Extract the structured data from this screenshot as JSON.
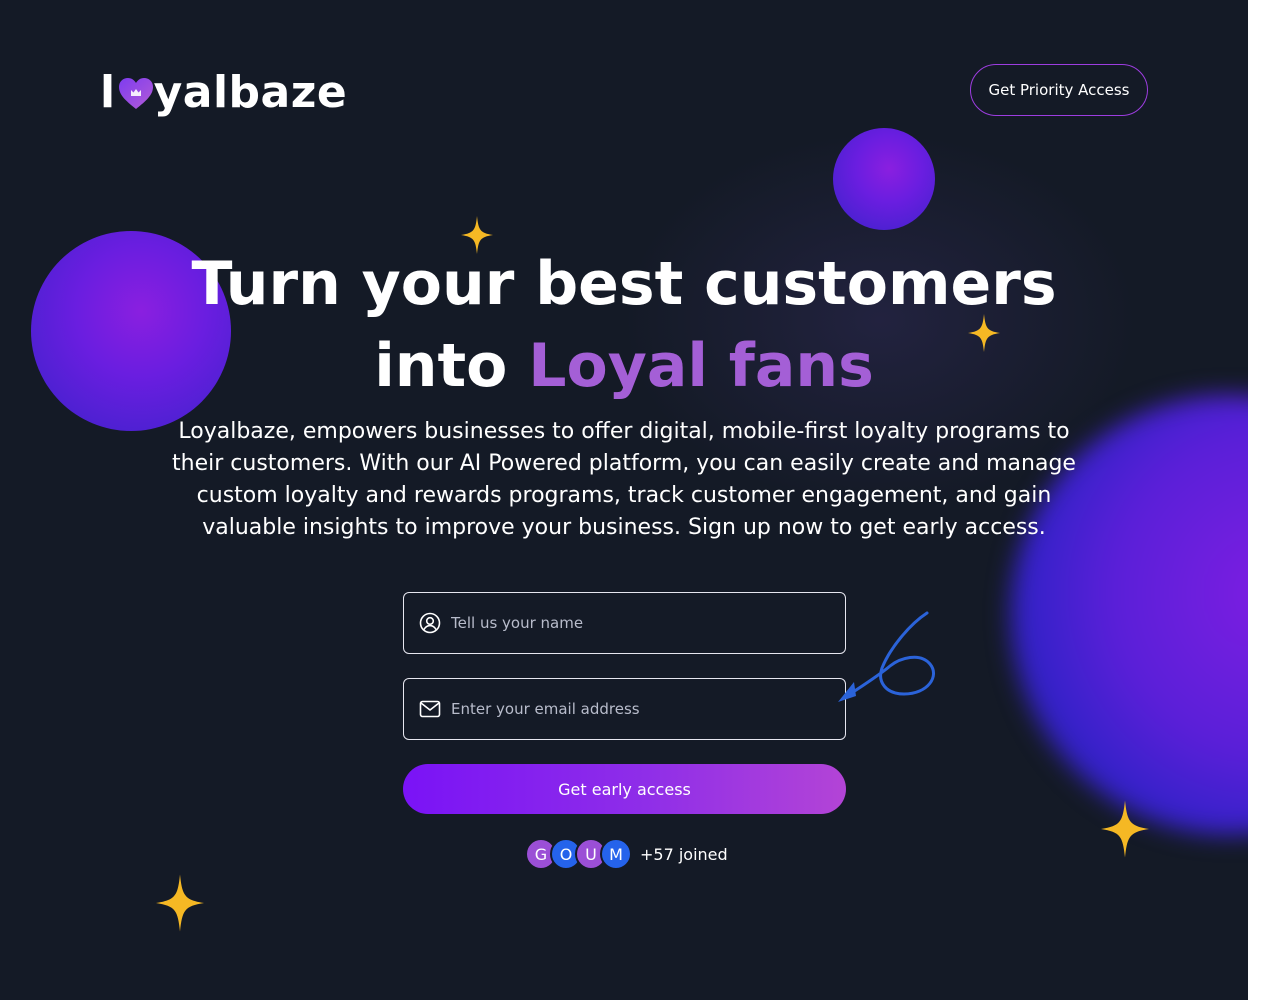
{
  "brand": {
    "logo_prefix": "l",
    "logo_suffix": "yalbaze",
    "heart_icon": "heart-crown-icon"
  },
  "header": {
    "priority_button_label": "Get Priority Access"
  },
  "hero": {
    "headline_line1": "Turn your best customers",
    "headline_line2_plain": "into ",
    "headline_line2_accent": "Loyal fans",
    "subtitle": "Loyalbaze, empowers businesses to offer digital, mobile-first loyalty programs to their customers. With our AI Powered platform, you can easily create and manage custom loyalty and rewards programs, track customer engagement, and gain valuable insights to improve your business. Sign up now to get early access."
  },
  "form": {
    "name_placeholder": "Tell us your name",
    "name_icon": "user-circle-icon",
    "email_placeholder": "Enter your email address",
    "email_icon": "envelope-icon",
    "submit_label": "Get early access"
  },
  "social_proof": {
    "avatars": [
      {
        "letter": "G",
        "color": "#9b4fd6"
      },
      {
        "letter": "O",
        "color": "#2563eb"
      },
      {
        "letter": "U",
        "color": "#9b4fd6"
      },
      {
        "letter": "M",
        "color": "#2563eb"
      }
    ],
    "joined_text": "+57 joined"
  },
  "colors": {
    "background": "#141a26",
    "accent_purple": "#a45fd6",
    "button_gradient_start": "#7a13f6",
    "button_gradient_end": "#b344d6",
    "sparkle": "#f5b824",
    "arrow": "#2b63d9"
  }
}
